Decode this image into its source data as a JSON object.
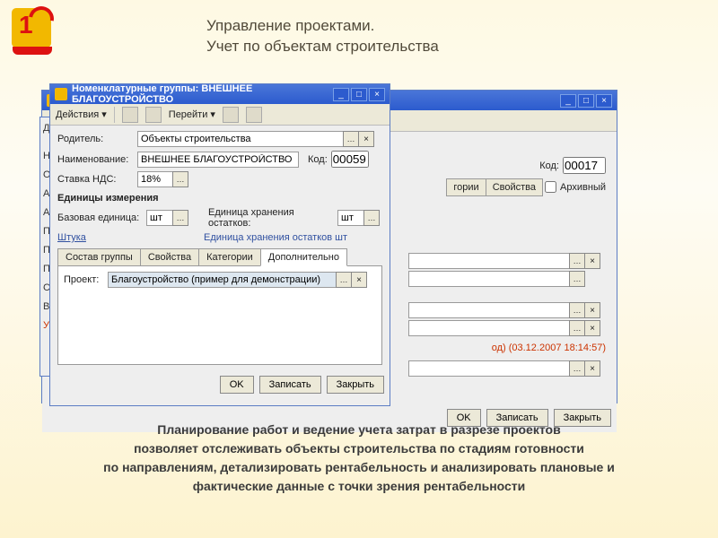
{
  "page": {
    "title": "Управление проектами.\nУчет по объектам строительства"
  },
  "bgwin": {
    "title": "",
    "kod_label": "Код:",
    "kod_value": "00017",
    "arch_label": "Архивный",
    "tabs": {
      "t1": "гории",
      "t2": "Свойства"
    },
    "red_note": "од) (03.12.2007 18:14:57)",
    "ok": "OK",
    "save": "Записать",
    "close": "Закрыть"
  },
  "leftcol": {
    "r0": "Дей",
    "r1": "Наи",
    "r2": "Ос",
    "r3": "Ад",
    "r4": "Ад",
    "r5": "Пл",
    "r6": "Пл",
    "r7": "Пл",
    "r8": "Ск",
    "r9": "Ви",
    "r10": "Уп"
  },
  "frontwin": {
    "title": "Номенклатурные группы: ВНЕШНЕЕ БЛАГОУСТРОЙСТВО",
    "toolbar": {
      "actions": "Действия ▾",
      "goto": "Перейти ▾"
    },
    "parent_label": "Родитель:",
    "parent_value": "Объекты строительства",
    "name_label": "Наименование:",
    "name_value": "ВНЕШНЕЕ БЛАГОУСТРОЙСТВО",
    "kod_label": "Код:",
    "kod_value": "00059",
    "vat_label": "Ставка НДС:",
    "vat_value": "18%",
    "units_title": "Единицы измерения",
    "base_label": "Базовая единица:",
    "base_value": "шт",
    "storage_label": "Единица хранения остатков:",
    "storage_value": "шт",
    "piece_link": "Штука",
    "storage_note": "Единица хранения остатков шт",
    "tabs": {
      "t1": "Состав группы",
      "t2": "Свойства",
      "t3": "Категории",
      "t4": "Дополнительно"
    },
    "project_label": "Проект:",
    "project_value": "Благоустройство (пример для демонстрации)",
    "ok": "OK",
    "save": "Записать",
    "close": "Закрыть"
  },
  "caption": {
    "l1": "Планирование работ и ведение учета затрат в разрезе проектов",
    "l2": "позволяет отслеживать объекты строительства по стадиям готовности",
    "l3": "по направлениям, детализировать рентабельность и анализировать плановые и",
    "l4": "фактические данные с точки зрения рентабельности"
  }
}
